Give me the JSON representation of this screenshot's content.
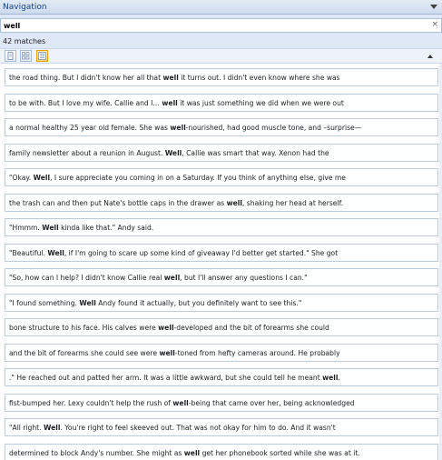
{
  "pane": {
    "title": "Navigation"
  },
  "search": {
    "value": "well",
    "clear_glyph": "×"
  },
  "match_count": "42 matches",
  "toolbar": {
    "buttons": [
      "headings-view-icon",
      "thumbnails-view-icon",
      "results-view-icon"
    ]
  },
  "results": [
    {
      "text": "the road thing. But I didn't know her all that well it turns out. I didn't even know where she was"
    },
    {
      "text": "to be with. But I love my wife. Callie and I… well it was just something we did when we were out"
    },
    {
      "text": "a normal healthy 25 year old female. She was well-nourished, had good muscle tone, and –surprise—"
    },
    {
      "text": "family newsletter about a reunion in August. Well, Callie was smart that way. Xenon had the"
    },
    {
      "text": "\"Okay. Well, I sure appreciate you coming in on a Saturday. If you think of anything else, give me"
    },
    {
      "text": "the trash can and then put Nate's bottle caps in the drawer as well, shaking her head at herself."
    },
    {
      "text": "\"Hmmm. Well kinda like that.\" Andy said."
    },
    {
      "text": "\"Beautiful. Well, if I'm going to scare up some kind of giveaway I'd better get started.\" She got"
    },
    {
      "text": "\"So, how can I help? I didn't know Callie real well, but I'll answer any questions I can.\""
    },
    {
      "text": "\"I found something. Well Andy found it actually, but you definitely want to see this.\""
    },
    {
      "text": "bone structure to his face. His calves were well-developed and the bit of forearms she could"
    },
    {
      "text": "and the bit of forearms she could see were well-toned from hefty cameras around. He probably"
    },
    {
      "text": ".\" He reached out and patted her arm. It was a little awkward, but she could tell he meant well."
    },
    {
      "text": "fist-bumped her. Lexy couldn't help the rush of well-being that came over her, being acknowledged"
    },
    {
      "text": "\"All right. Well. You're right to feel skeeved out. That was not okay for him to do. And it wasn't"
    },
    {
      "text": "determined to block Andy's number. She might as well get her phonebook sorted while she was at it."
    }
  ],
  "colors": {
    "accent": "#15428b",
    "pane_bg": "#dfe8f6",
    "result_border": "#bccbe0"
  }
}
